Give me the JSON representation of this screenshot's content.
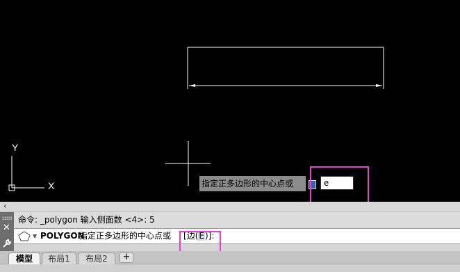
{
  "canvas": {
    "ucs_y_label": "Y",
    "ucs_x_label": "X",
    "dynamic_input": {
      "prompt": "指定正多边形的中心点或",
      "value": "e"
    }
  },
  "command": {
    "history": "命令: _polygon 输入侧面数 <4>: 5",
    "command_name": "POLYGON",
    "prompt": "指定正多边形的中心点或",
    "option_open": "[",
    "option_label": "边(",
    "option_key": "E",
    "option_close": ")]:"
  },
  "tabs": {
    "items": [
      "模型",
      "布局1",
      "布局2"
    ],
    "active_index": 0,
    "add_label": "+"
  },
  "colors": {
    "highlight": "#e83cd6",
    "canvas_bg": "#000000",
    "option_key_bg": "#d5dcf0"
  }
}
